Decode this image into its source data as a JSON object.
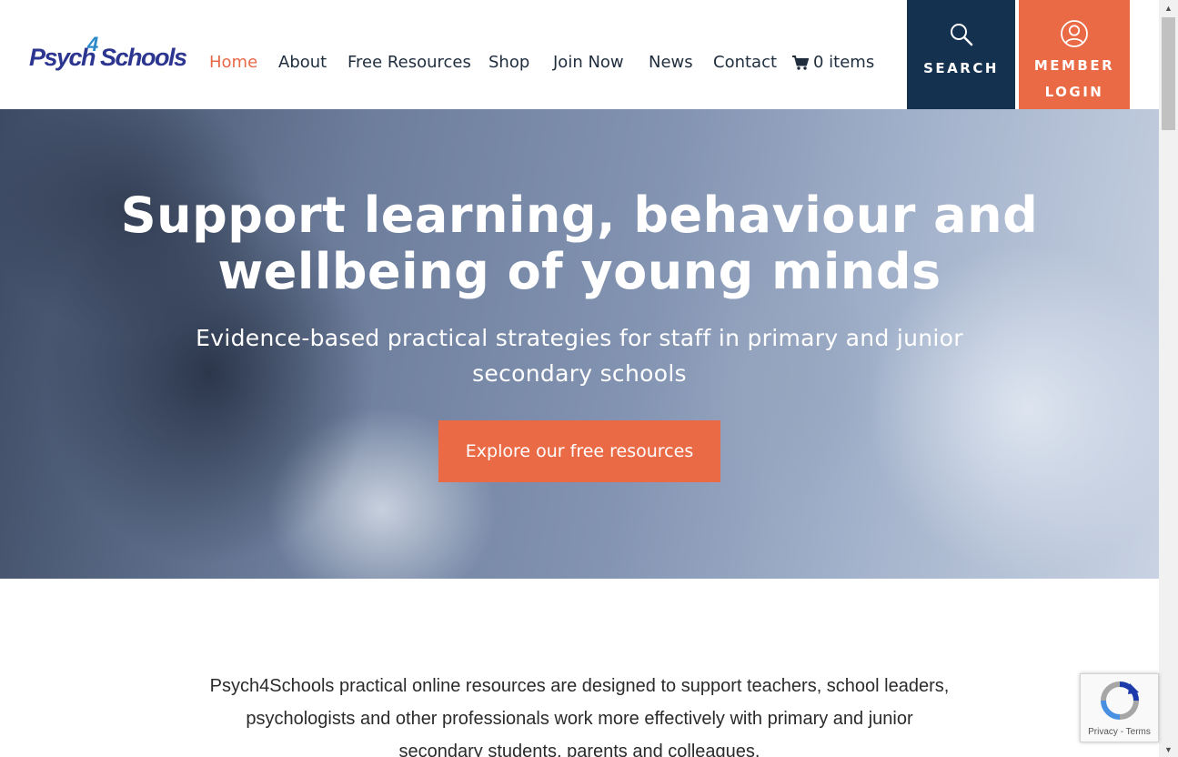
{
  "logo": {
    "part1": "Psych",
    "part2": "4",
    "part3": "Schools"
  },
  "nav": {
    "items": [
      {
        "label": "Home",
        "active": true
      },
      {
        "label": "About"
      },
      {
        "label": "Free Resources"
      },
      {
        "label": "Shop"
      },
      {
        "label": "Join Now"
      },
      {
        "label": "News"
      },
      {
        "label": "Contact"
      }
    ],
    "cart_label": "0 items"
  },
  "header_buttons": {
    "search_label": "SEARCH",
    "login_line1": "MEMBER",
    "login_line2": "LOGIN"
  },
  "hero": {
    "title_line1": "Support learning, behaviour and",
    "title_line2": "wellbeing of young minds",
    "subtitle": "Evidence-based practical strategies for staff in primary and junior secondary schools",
    "cta": "Explore our free resources"
  },
  "intro": {
    "text": "Psych4Schools practical online resources are designed to support teachers, school leaders, psychologists and other professionals work more effectively with primary and junior secondary students, parents and colleagues."
  },
  "recaptcha": {
    "privacy": "Privacy",
    "separator": " - ",
    "terms": "Terms"
  },
  "colors": {
    "accent": "#ea6a45",
    "navy": "#143150",
    "logo_blue": "#2c3590"
  },
  "icons": [
    "search-icon",
    "user-icon",
    "cart-icon",
    "recaptcha-icon"
  ]
}
